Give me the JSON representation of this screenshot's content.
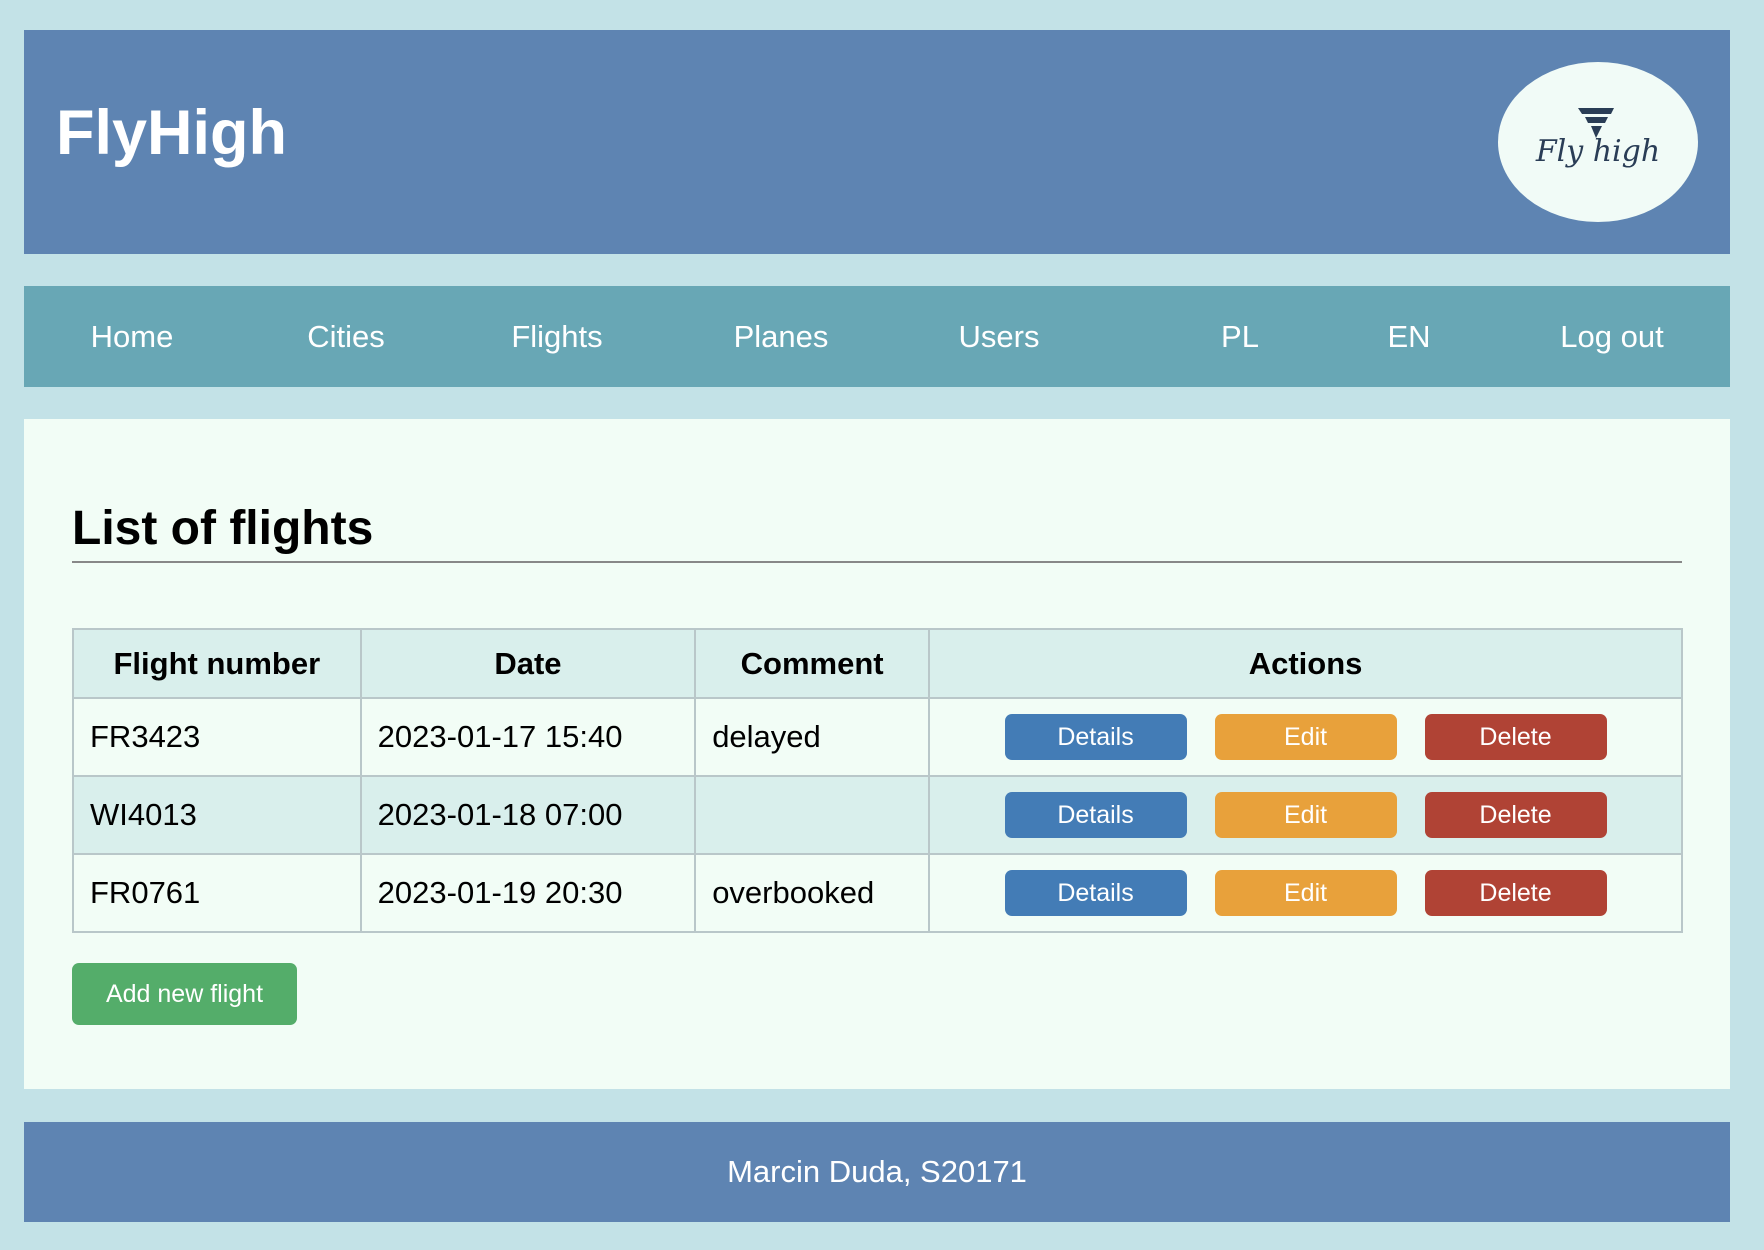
{
  "header": {
    "title": "FlyHigh",
    "logo_text": "Fly high"
  },
  "nav": {
    "items": [
      {
        "label": "Home"
      },
      {
        "label": "Cities"
      },
      {
        "label": "Flights"
      },
      {
        "label": "Planes"
      },
      {
        "label": "Users"
      },
      {
        "label": "PL"
      },
      {
        "label": "EN"
      },
      {
        "label": "Log out"
      }
    ]
  },
  "main": {
    "title": "List of flights",
    "table": {
      "columns": [
        "Flight number",
        "Date",
        "Comment",
        "Actions"
      ],
      "rows": [
        {
          "flight_number": "FR3423",
          "date": "2023-01-17 15:40",
          "comment": "delayed"
        },
        {
          "flight_number": "WI4013",
          "date": "2023-01-18 07:00",
          "comment": ""
        },
        {
          "flight_number": "FR0761",
          "date": "2023-01-19 20:30",
          "comment": "overbooked"
        }
      ]
    },
    "actions": {
      "details": "Details",
      "edit": "Edit",
      "delete": "Delete"
    },
    "add_button": "Add new flight"
  },
  "footer": {
    "text": "Marcin Duda, S20171"
  },
  "colors": {
    "page_bg": "#c3e2e7",
    "header_bg": "#5e84b2",
    "nav_bg": "#68a7b5",
    "content_bg": "#f2fdf6",
    "details": "#437cb6",
    "edit": "#e8a13b",
    "delete": "#b04335",
    "add": "#54ad6a"
  }
}
